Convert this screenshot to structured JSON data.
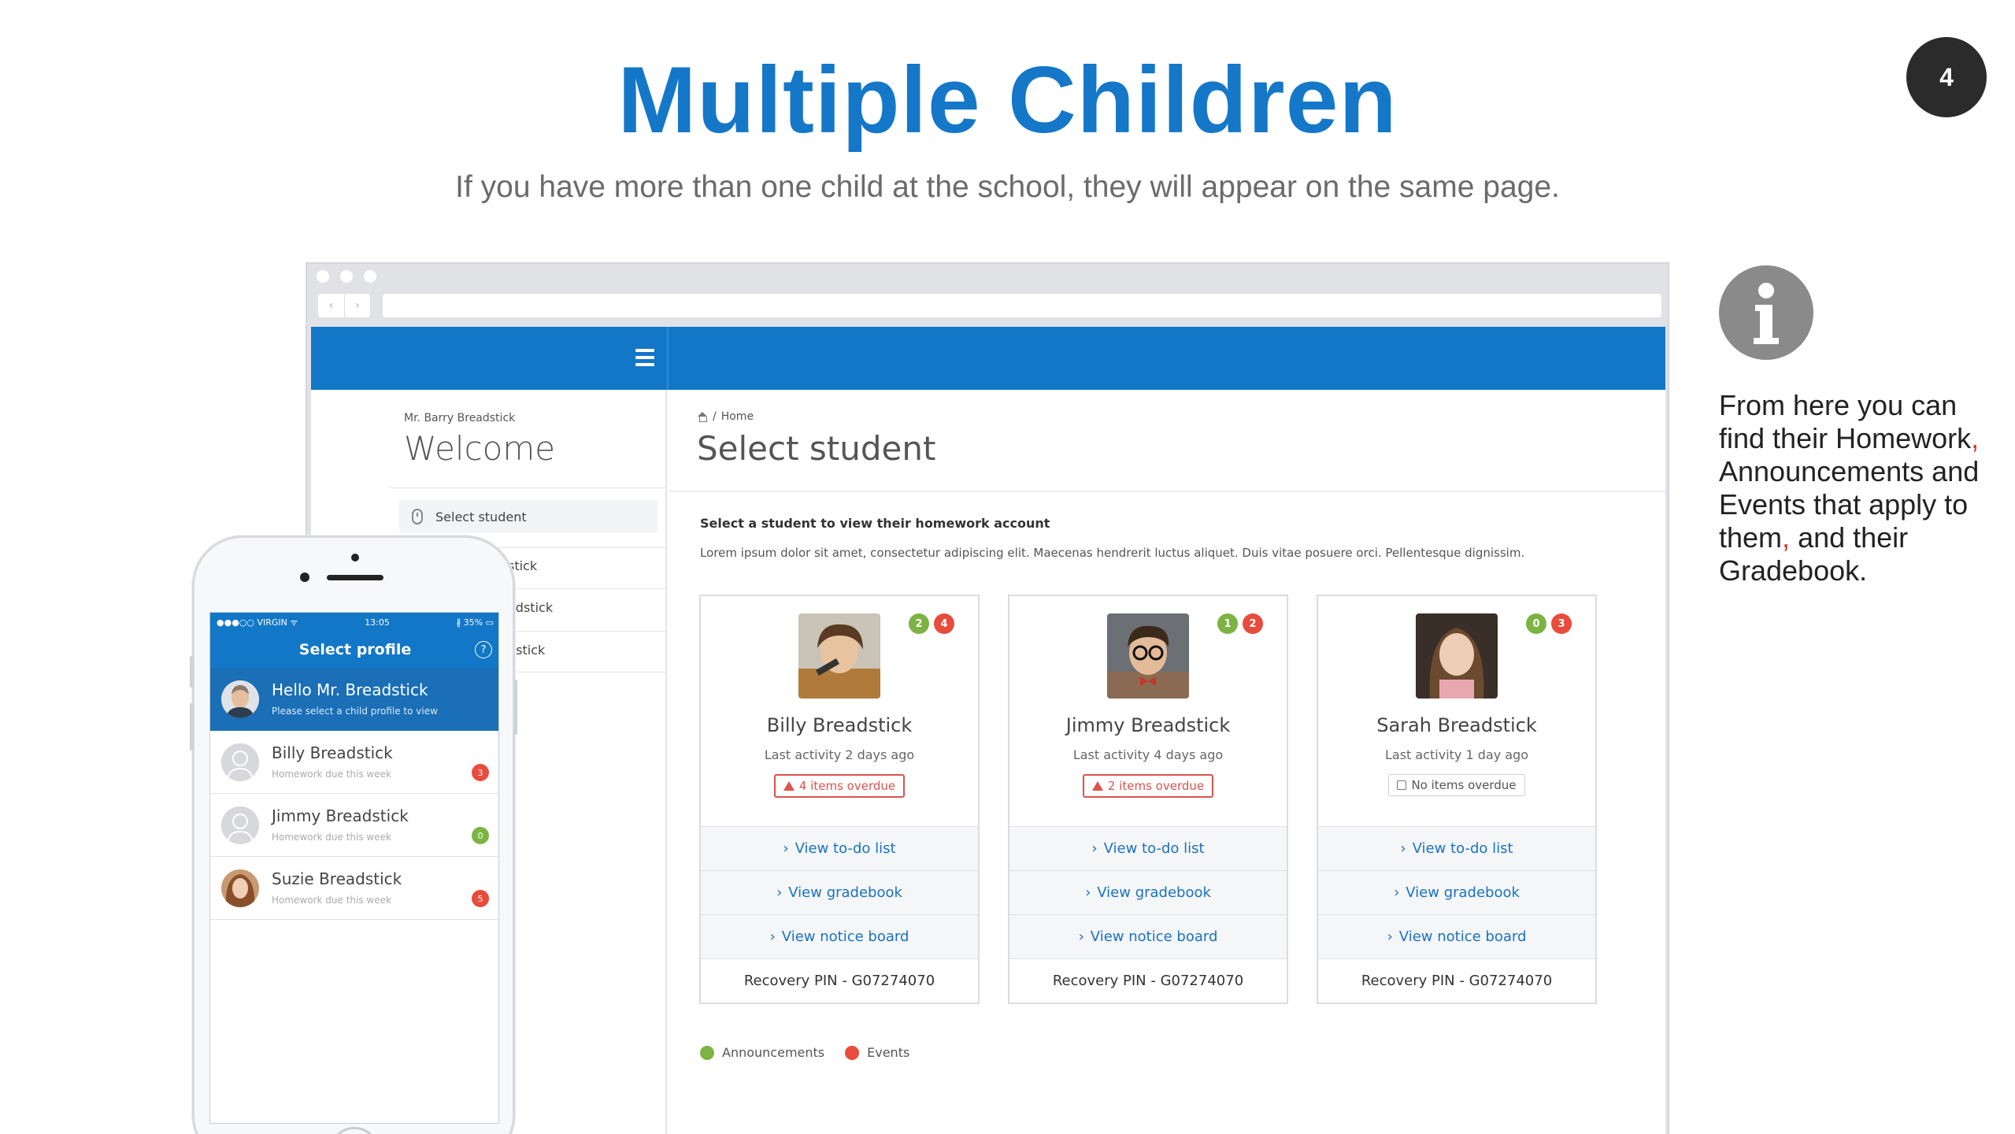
{
  "slide": {
    "title": "Multiple Children",
    "subtitle": "If you have more than one child at the school, they will appear on the same page.",
    "page_number": "4"
  },
  "colors": {
    "brand_blue": "#1277c7",
    "announcements": "#7cb342",
    "events": "#e74c3c",
    "overdue": "#d9534f"
  },
  "browser": {
    "nav_back": "‹",
    "nav_forward": "›",
    "sidebar": {
      "user": "Mr. Barry Breadstick",
      "welcome": "Welcome",
      "select_student": "Select student",
      "items": [
        "stick",
        "adstick",
        "dstick"
      ]
    },
    "main": {
      "breadcrumb_sep": "/",
      "breadcrumb": "Home",
      "title": "Select student",
      "instruction": "Select a student to view their homework account",
      "lorem": "Lorem ipsum dolor sit amet, consectetur adipiscing elit. Maecenas hendrerit luctus aliquet. Duis vitae posuere orci. Pellentesque dignissim."
    },
    "students": [
      {
        "name": "Billy Breadstick",
        "activity": "Last activity 2 days ago",
        "overdue": "4 items overdue",
        "announcements": "2",
        "events": "4",
        "links": [
          "View to-do list",
          "View gradebook",
          "View notice board"
        ],
        "pin": "Recovery PIN - G07274070"
      },
      {
        "name": "Jimmy Breadstick",
        "activity": "Last activity 4 days ago",
        "overdue": "2 items overdue",
        "announcements": "1",
        "events": "2",
        "links": [
          "View to-do list",
          "View gradebook",
          "View notice board"
        ],
        "pin": "Recovery PIN - G07274070"
      },
      {
        "name": "Sarah Breadstick",
        "activity": "Last activity 1 day ago",
        "overdue": "No items overdue",
        "announcements": "0",
        "events": "3",
        "links": [
          "View to-do list",
          "View gradebook",
          "View notice board"
        ],
        "pin": "Recovery PIN - G07274070"
      }
    ],
    "legend": {
      "announcements": "Announcements",
      "events": "Events"
    },
    "link_chevron": "›"
  },
  "phone": {
    "status_carrier": "●●●○○ VIRGIN ᯤ",
    "status_time": "13:05",
    "status_battery": "∦ 35% ▭",
    "header": "Select profile",
    "help": "?",
    "hello_title": "Hello Mr. Breadstick",
    "hello_sub": "Please select a child profile to view",
    "profiles": [
      {
        "name": "Billy Breadstick",
        "sub": "Homework due this week",
        "count": "3",
        "color": "#e74c3c"
      },
      {
        "name": "Jimmy Breadstick",
        "sub": "Homework due this week",
        "count": "0",
        "color": "#7cb342"
      },
      {
        "name": "Suzie Breadstick",
        "sub": "Homework due this week",
        "count": "5",
        "color": "#e74c3c"
      }
    ]
  },
  "info": {
    "icon": "info-icon",
    "text_1": "From here you can find their Homework",
    "comma_1": ",",
    "text_2": " Announcements and Events that apply to them",
    "comma_2": ",",
    "text_3": " and their Gradebook."
  }
}
